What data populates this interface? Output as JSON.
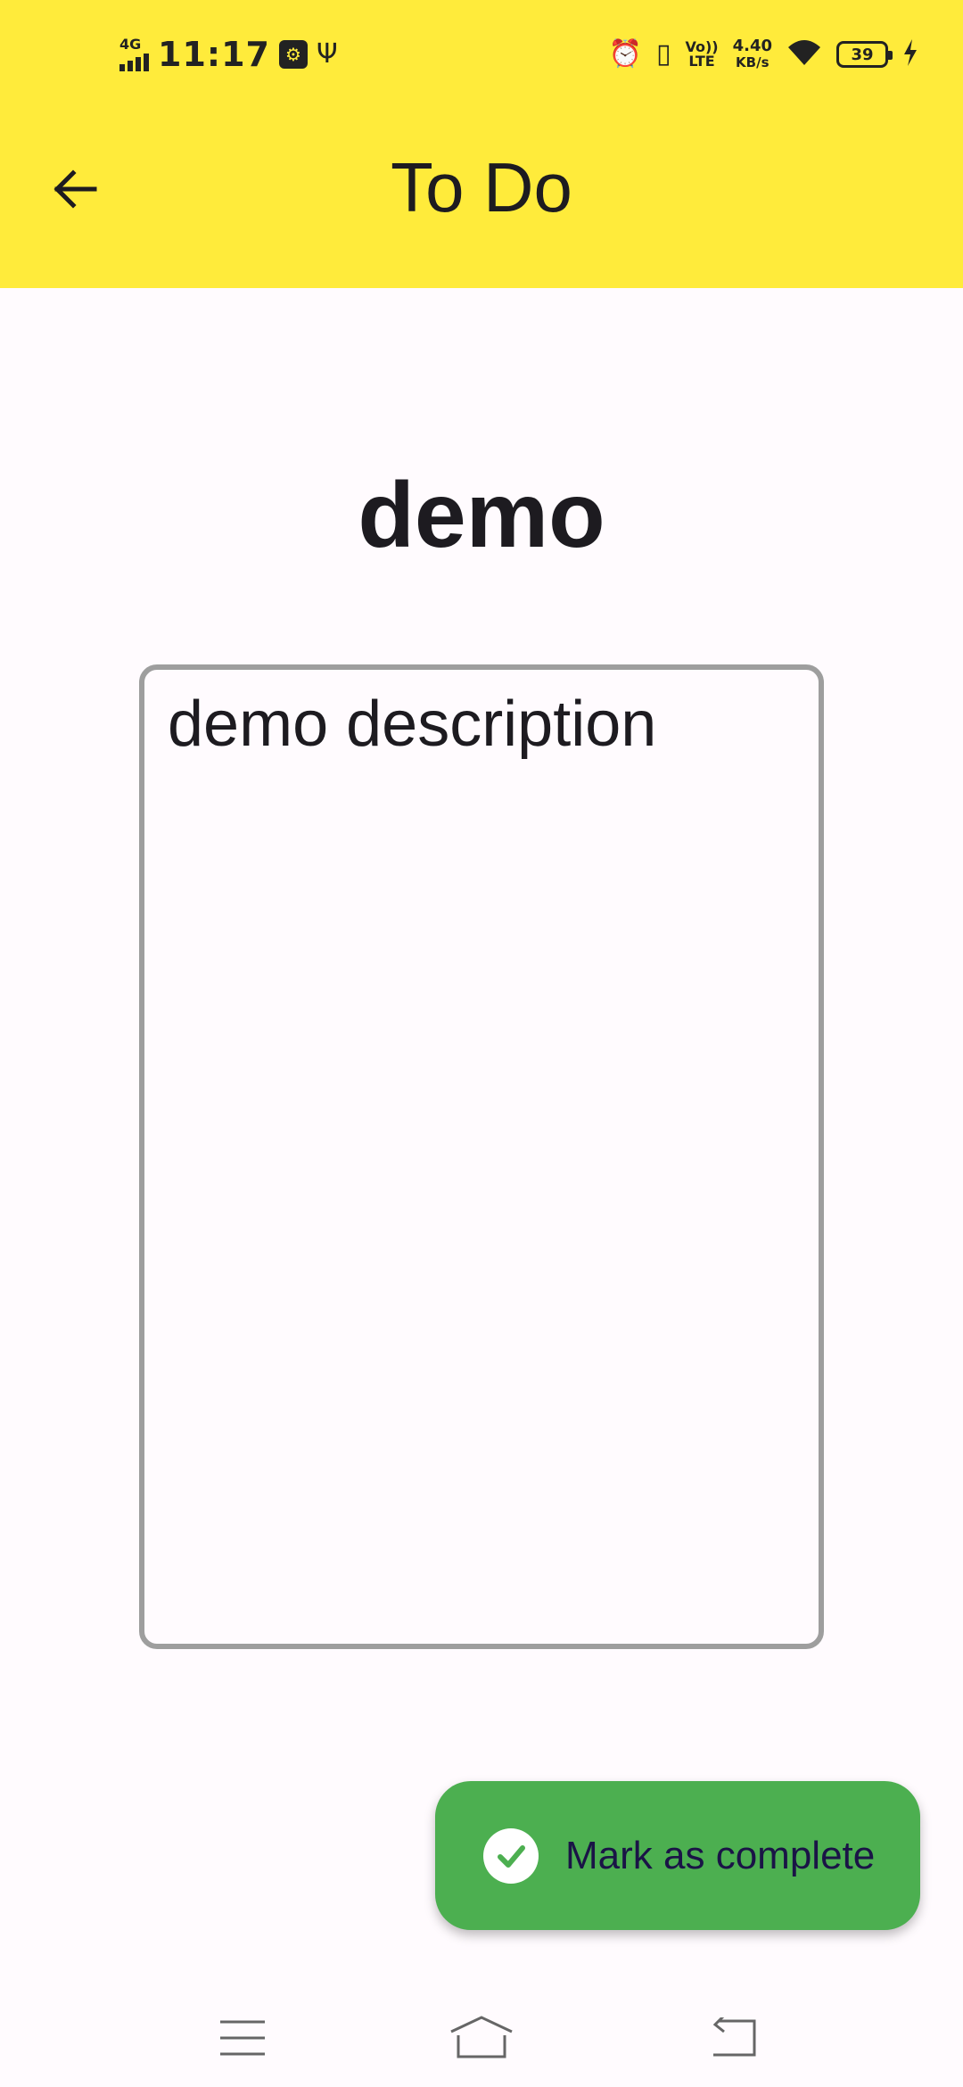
{
  "status_bar": {
    "network_type": "4G",
    "time": "11:17",
    "usb_debug_icon": "usb-settings-icon",
    "usb_icon": "usb-icon",
    "alarm_icon": "alarm-icon",
    "vibrate_icon": "vibrate-icon",
    "volte_label_top": "Vo))",
    "volte_label_bottom": "LTE",
    "speed_value": "4.40",
    "speed_unit": "KB/s",
    "wifi_icon": "wifi-icon",
    "battery_level": "39",
    "charging_icon": "charging-icon"
  },
  "app_bar": {
    "title": "To Do",
    "back_icon": "arrow-back-icon",
    "background_color": "#ffeb3b"
  },
  "todo": {
    "title": "demo",
    "description": "demo description"
  },
  "fab": {
    "label": "Mark as complete",
    "icon": "check-circle-icon",
    "color": "#4caf50"
  },
  "nav_bar": {
    "menu_icon": "menu-icon",
    "home_icon": "home-icon",
    "back_icon": "back-icon"
  }
}
